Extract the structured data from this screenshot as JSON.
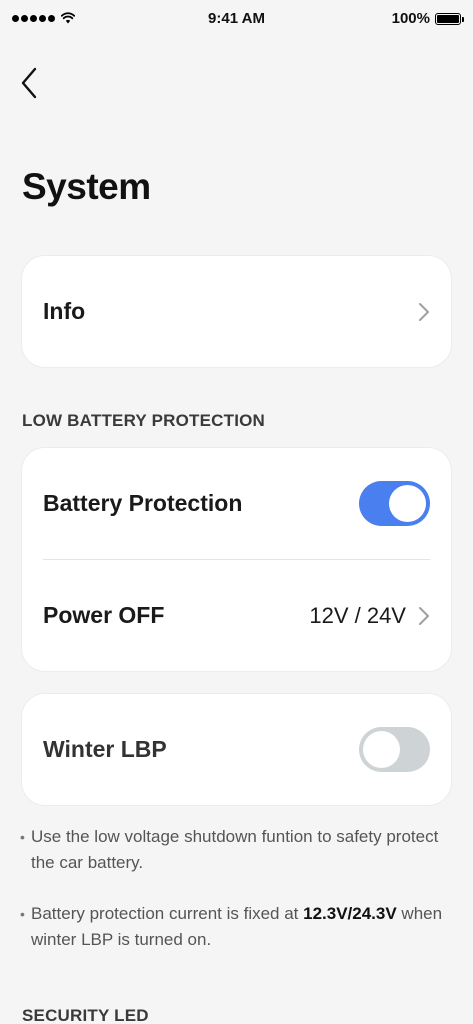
{
  "status_bar": {
    "time": "9:41 AM",
    "battery_percent": "100%",
    "signal_icon": "signal-dots-icon",
    "wifi_icon": "wifi-icon",
    "battery_icon": "battery-full-icon"
  },
  "nav": {
    "back_icon": "chevron-left-icon"
  },
  "page": {
    "title": "System"
  },
  "info_card": {
    "label": "Info",
    "chevron_icon": "chevron-right-icon"
  },
  "low_battery": {
    "section_title": "LOW BATTERY PROTECTION",
    "battery_protection": {
      "label": "Battery Protection",
      "enabled": true
    },
    "power_off": {
      "label": "Power OFF",
      "value": "12V / 24V",
      "chevron_icon": "chevron-right-icon"
    }
  },
  "winter": {
    "label": "Winter LBP",
    "enabled": false
  },
  "notes": {
    "note1": "Use the low voltage shutdown funtion to safety protect the car battery.",
    "note2_prefix": "Battery protection current is fixed at ",
    "note2_bold": "12.3V/24.3V",
    "note2_suffix": " when winter LBP is turned on.",
    "bullet": "•"
  },
  "security": {
    "section_title": "SECURITY LED"
  },
  "colors": {
    "accent": "#4a7ff0",
    "toggle_off": "#ced3d6",
    "background": "#f5f5f5"
  }
}
